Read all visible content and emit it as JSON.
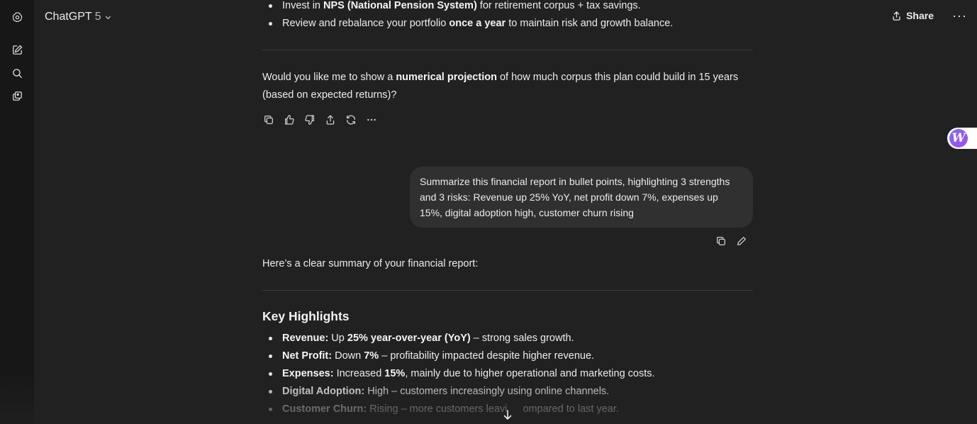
{
  "header": {
    "model_name": "ChatGPT",
    "model_version": "5",
    "share_label": "Share",
    "more_label": "···"
  },
  "sidebar_icons": [
    "logo-icon",
    "new-chat-icon",
    "search-icon",
    "library-icon"
  ],
  "previous_answer": {
    "bullets": [
      {
        "pre": "Invest in ",
        "bold": "NPS (National Pension System)",
        "post": " for retirement corpus + tax savings."
      },
      {
        "pre": "Review and rebalance your portfolio ",
        "bold": "once a year",
        "post": " to maintain risk and growth balance."
      }
    ],
    "question": {
      "pre": "Would you like me to show a ",
      "bold": "numerical projection",
      "post": " of how much corpus this plan could build in 15 years (based on expected returns)?"
    }
  },
  "user_message": "Summarize this financial report in bullet points, highlighting 3 strengths and 3 risks: Revenue up 25% YoY, net profit down 7%, expenses up 15%, digital adoption high, customer churn rising",
  "answer": {
    "intro": "Here’s a clear summary of your financial report:",
    "heading": "Key Highlights",
    "bullets": [
      {
        "label": "Revenue:",
        "t1": " Up ",
        "bold": "25% year-over-year (YoY)",
        "t2": " – strong sales growth."
      },
      {
        "label": "Net Profit:",
        "t1": " Down ",
        "bold": "7%",
        "t2": " – profitability impacted despite higher revenue."
      },
      {
        "label": "Expenses:",
        "t1": " Increased ",
        "bold": "15%",
        "t2": ", mainly due to higher operational and marketing costs."
      },
      {
        "label": "Digital Adoption:",
        "t1": " High – customers increasingly using online channels.",
        "bold": "",
        "t2": ""
      },
      {
        "label": "Customer Churn:",
        "t1": " Rising – more customers leavi",
        "bold": "",
        "t2": "ompared to last year."
      }
    ]
  }
}
